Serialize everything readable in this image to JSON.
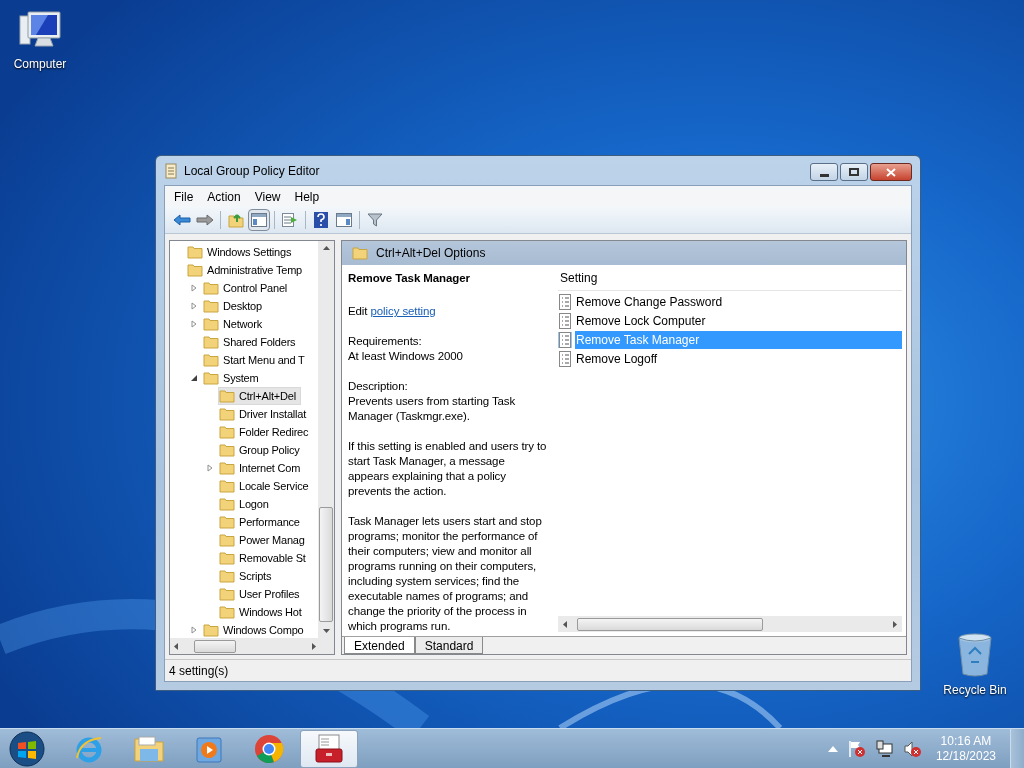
{
  "desktop_icons": [
    {
      "label": "Computer",
      "kind": "computer"
    },
    {
      "label": "Recycle Bin",
      "kind": "recycle"
    }
  ],
  "window": {
    "title": "Local Group Policy Editor"
  },
  "menu": [
    "File",
    "Action",
    "View",
    "Help"
  ],
  "toolbar": [
    {
      "kind": "back"
    },
    {
      "kind": "forward"
    },
    {
      "kind": "sep"
    },
    {
      "kind": "up"
    },
    {
      "kind": "tree",
      "selected": true
    },
    {
      "kind": "sep"
    },
    {
      "kind": "export"
    },
    {
      "kind": "sep"
    },
    {
      "kind": "help"
    },
    {
      "kind": "pane"
    },
    {
      "kind": "sep"
    },
    {
      "kind": "filter"
    }
  ],
  "tree": [
    {
      "label": "Windows Settings",
      "selected": false
    },
    {
      "label": "Administrative Temp",
      "selected": false,
      "children": [
        {
          "label": "Control Panel",
          "selected": false,
          "expanded": false
        },
        {
          "label": "Desktop",
          "selected": false,
          "expanded": false
        },
        {
          "label": "Network",
          "selected": false,
          "expanded": false
        },
        {
          "label": "Shared Folders",
          "selected": false
        },
        {
          "label": "Start Menu and T",
          "selected": false
        },
        {
          "label": "System",
          "selected": false,
          "expanded": true,
          "children": [
            {
              "label": "Ctrl+Alt+Del",
              "selected": true
            },
            {
              "label": "Driver Installat",
              "selected": false
            },
            {
              "label": "Folder Redirec",
              "selected": false
            },
            {
              "label": "Group Policy",
              "selected": false
            },
            {
              "label": "Internet Com",
              "selected": false,
              "expanded": false
            },
            {
              "label": "Locale Service",
              "selected": false
            },
            {
              "label": "Logon",
              "selected": false
            },
            {
              "label": "Performance",
              "selected": false
            },
            {
              "label": "Power Manag",
              "selected": false
            },
            {
              "label": "Removable St",
              "selected": false
            },
            {
              "label": "Scripts",
              "selected": false
            },
            {
              "label": "User Profiles",
              "selected": false
            },
            {
              "label": "Windows Hot",
              "selected": false
            }
          ]
        },
        {
          "label": "Windows Compo",
          "selected": false,
          "expanded": false
        }
      ]
    }
  ],
  "pane": {
    "title": "Ctrl+Alt+Del Options",
    "description": {
      "heading": "Remove Task Manager",
      "edit_prefix": "Edit",
      "edit_link": "policy setting",
      "requirements_label": "Requirements:",
      "requirements": "At least Windows 2000",
      "description_label": "Description:",
      "paragraphs": [
        "Prevents users from starting Task Manager (Taskmgr.exe).",
        "If this setting is enabled and users try to start Task Manager, a message appears explaining that a policy prevents the action.",
        "Task Manager lets users start and stop programs; monitor the performance of their computers; view and monitor all programs running on their computers, including system services; find the executable names of programs; and change the priority of the process in which programs run."
      ]
    },
    "column": "Setting",
    "settings": [
      {
        "label": "Remove Change Password",
        "selected": false
      },
      {
        "label": "Remove Lock Computer",
        "selected": false
      },
      {
        "label": "Remove Task Manager",
        "selected": true
      },
      {
        "label": "Remove Logoff",
        "selected": false
      }
    ],
    "tabs": [
      {
        "label": "Extended",
        "selected": true
      },
      {
        "label": "Standard",
        "selected": false
      }
    ]
  },
  "status_bar": "4 setting(s)",
  "taskbar": {
    "apps": [
      {
        "kind": "ie",
        "active": false
      },
      {
        "kind": "explorer",
        "active": false
      },
      {
        "kind": "media",
        "active": false
      },
      {
        "kind": "chrome",
        "active": false
      },
      {
        "kind": "gpedit",
        "active": true
      }
    ],
    "time": "10:16 AM",
    "date": "12/18/2023"
  }
}
